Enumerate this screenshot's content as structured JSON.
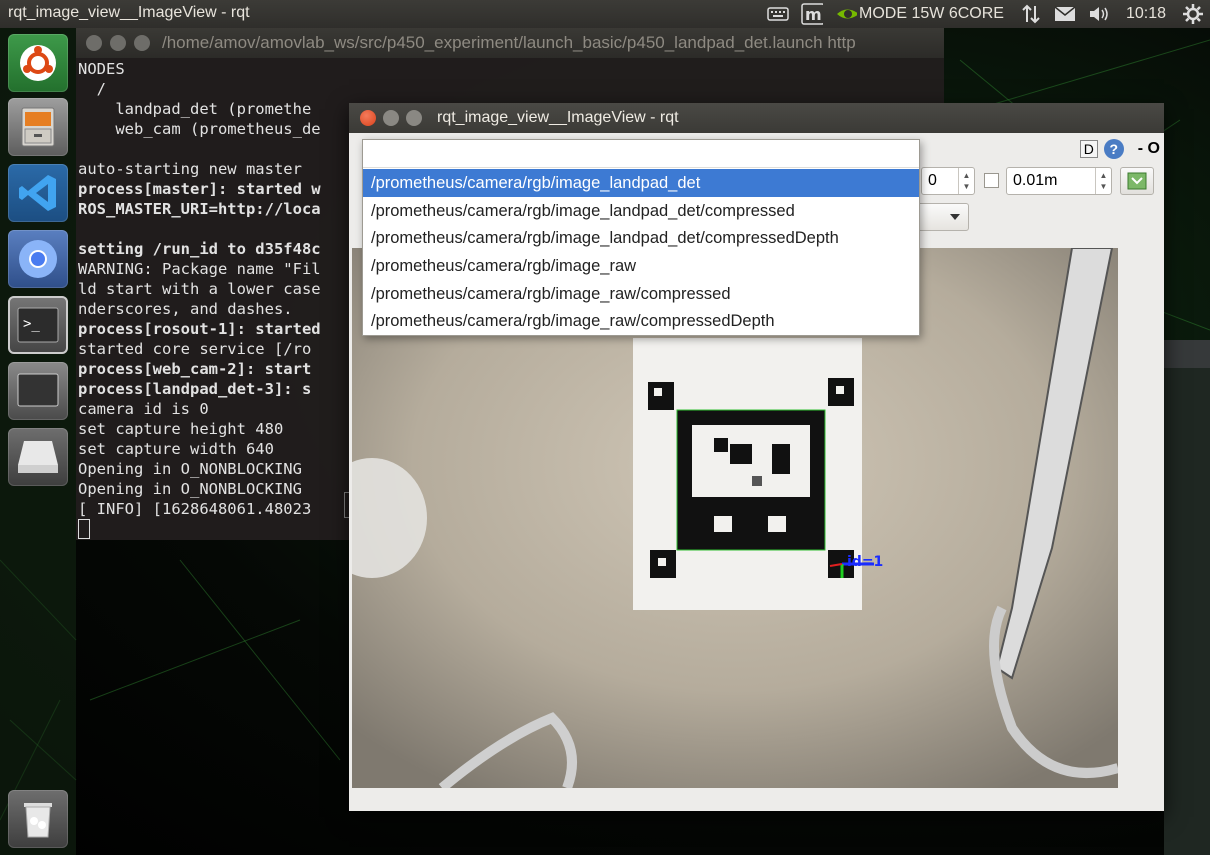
{
  "top_panel": {
    "app_title": "rqt_image_view__ImageView - rqt",
    "power_mode": "MODE 15W 6CORE",
    "clock": "10:18",
    "icons": [
      "keyboard-icon",
      "m-indicator-icon",
      "nvidia-icon",
      "network-updown-icon",
      "mail-icon",
      "volume-icon",
      "settings-gear-icon"
    ]
  },
  "launcher": {
    "items": [
      "ubuntu-dash",
      "files",
      "vscode",
      "chromium",
      "terminal",
      "screen",
      "drive",
      "trash"
    ]
  },
  "terminal": {
    "title": "/home/amov/amovlab_ws/src/p450_experiment/launch_basic/p450_landpad_det.launch http",
    "lines": [
      {
        "text": "NODES",
        "bold": false
      },
      {
        "text": "  /",
        "bold": false
      },
      {
        "text": "    landpad_det (promethe",
        "bold": false
      },
      {
        "text": "    web_cam (prometheus_de",
        "bold": false
      },
      {
        "text": "",
        "bold": false
      },
      {
        "text": "auto-starting new master",
        "bold": false
      },
      {
        "text": "process[master]: started w",
        "bold": true
      },
      {
        "text": "ROS_MASTER_URI=http://loca",
        "bold": true
      },
      {
        "text": "",
        "bold": false
      },
      {
        "text": "setting /run_id to d35f48c",
        "bold": true
      },
      {
        "text": "WARNING: Package name \"Fil",
        "bold": false
      },
      {
        "text": "ld start with a lower case",
        "bold": false
      },
      {
        "text": "nderscores, and dashes.",
        "bold": false
      },
      {
        "text": "process[rosout-1]: started",
        "bold": true
      },
      {
        "text": "started core service [/ro",
        "bold": false
      },
      {
        "text": "process[web_cam-2]: start",
        "bold": true
      },
      {
        "text": "process[landpad_det-3]: s",
        "bold": true
      },
      {
        "text": "camera id is 0",
        "bold": false
      },
      {
        "text": "set capture height 480",
        "bold": false
      },
      {
        "text": "set capture width 640",
        "bold": false
      },
      {
        "text": "Opening in O_NONBLOCKING",
        "bold": false
      },
      {
        "text": "Opening in O_NONBLOCKING",
        "bold": false
      },
      {
        "text": "[ INFO] [1628648061.48023",
        "bold": false
      }
    ]
  },
  "rqt": {
    "title": "rqt_image_view__ImageView - rqt",
    "toolbar": {
      "d_label": "D",
      "help_label": "?",
      "dash_label": "- O",
      "spin_value": "0",
      "distance_value": "0.01m"
    },
    "topic_dropdown": {
      "options": [
        "/prometheus/camera/rgb/image_landpad_det",
        "/prometheus/camera/rgb/image_landpad_det/compressed",
        "/prometheus/camera/rgb/image_landpad_det/compressedDepth",
        "/prometheus/camera/rgb/image_raw",
        "/prometheus/camera/rgb/image_raw/compressed",
        "/prometheus/camera/rgb/image_raw/compressedDepth"
      ],
      "selected_index": 0
    },
    "detection_label": "id=1"
  },
  "colors": {
    "selection": "#3d7ad3",
    "ubuntu_orange": "#dd4814",
    "detection_blue": "#1a2cff",
    "detection_green": "#20d020"
  }
}
